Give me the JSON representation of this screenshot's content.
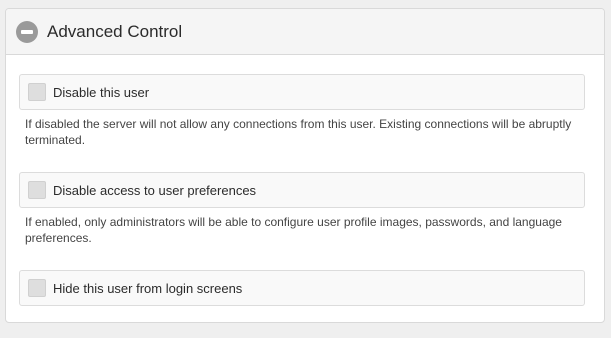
{
  "panel": {
    "title": "Advanced Control",
    "collapse_icon": "minus-circle-icon"
  },
  "options": [
    {
      "label": "Disable this user",
      "checked": false,
      "description": "If disabled the server will not allow any connections from this user. Existing connections will be abruptly terminated."
    },
    {
      "label": "Disable access to user preferences",
      "checked": false,
      "description": "If enabled, only administrators will be able to configure user profile images, passwords, and language preferences."
    },
    {
      "label": "Hide this user from login screens",
      "checked": false
    }
  ]
}
